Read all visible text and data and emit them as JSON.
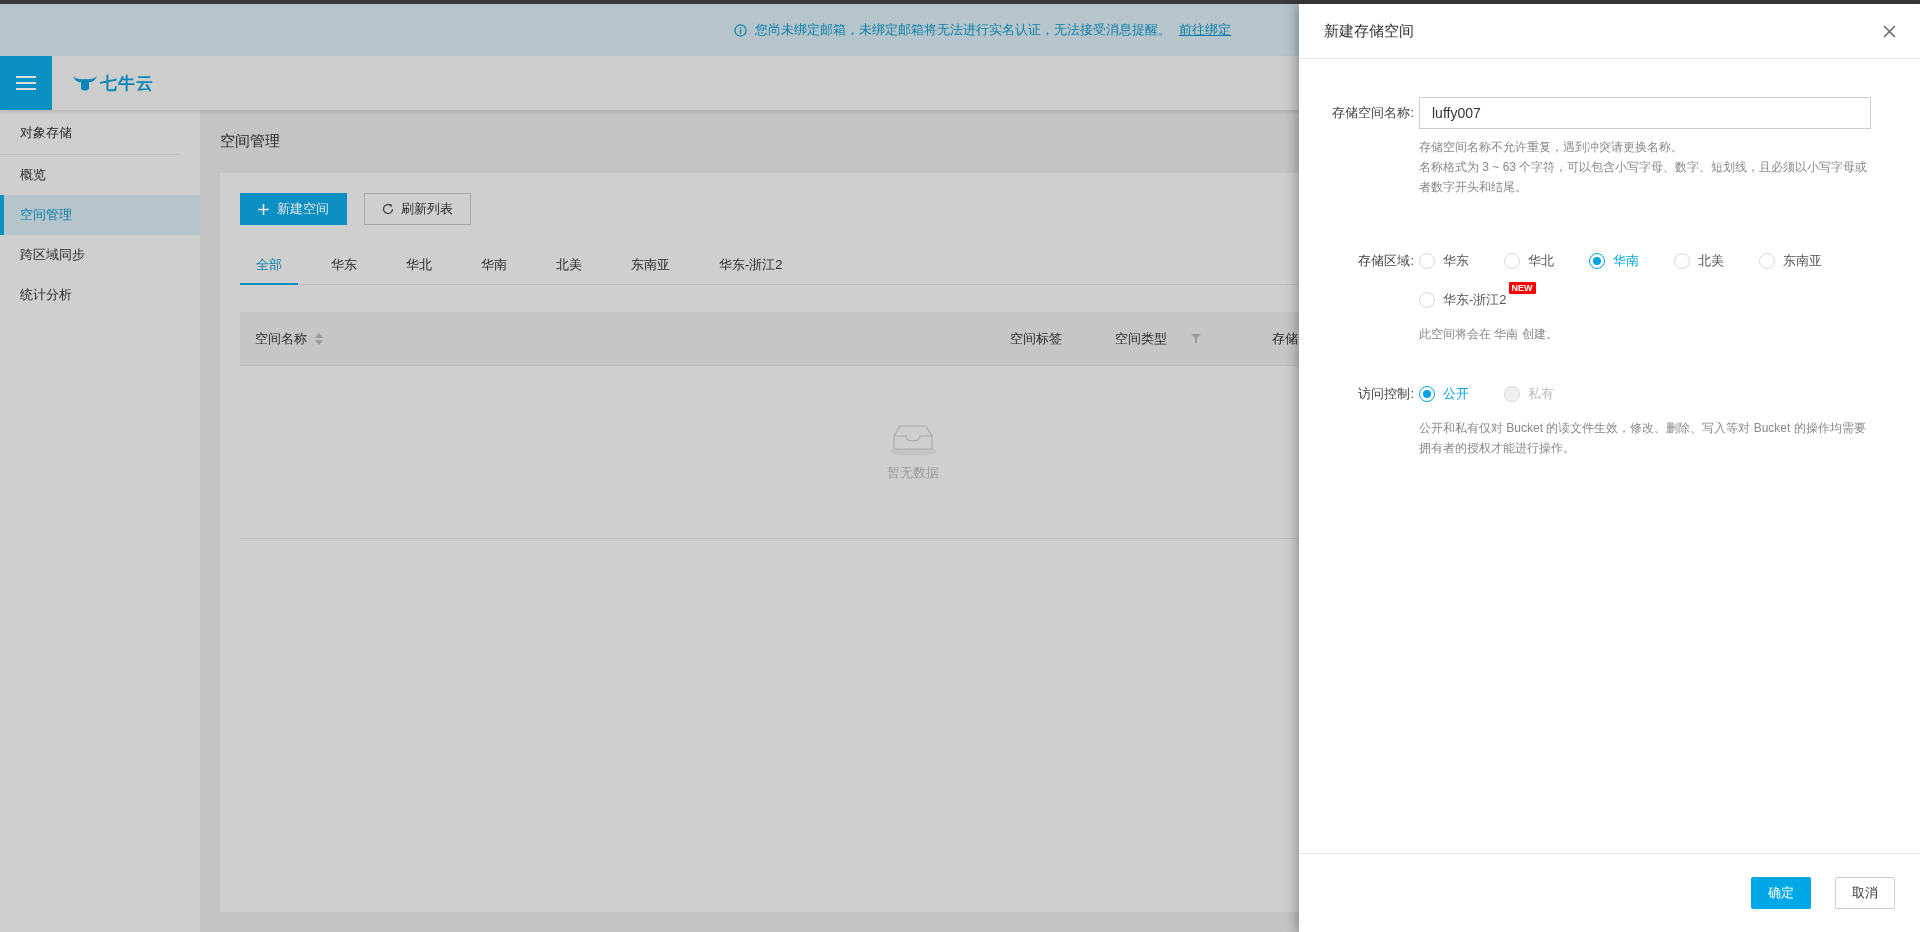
{
  "banner": {
    "message": "您尚未绑定邮箱，未绑定邮箱将无法进行实名认证，无法接受消息提醒。",
    "link": "前往绑定"
  },
  "header": {
    "logo_text": "七牛云"
  },
  "sidebar": {
    "section": "对象存储",
    "items": [
      {
        "label": "概览",
        "selected": false
      },
      {
        "label": "空间管理",
        "selected": true
      },
      {
        "label": "跨区域同步",
        "selected": false
      },
      {
        "label": "统计分析",
        "selected": false
      }
    ]
  },
  "page_title": "空间管理",
  "toolbar": {
    "new_button": "新建空间",
    "refresh_button": "刷新列表"
  },
  "region_tabs": [
    {
      "label": "全部",
      "selected": true
    },
    {
      "label": "华东",
      "selected": false
    },
    {
      "label": "华北",
      "selected": false
    },
    {
      "label": "华南",
      "selected": false
    },
    {
      "label": "北美",
      "selected": false
    },
    {
      "label": "东南亚",
      "selected": false
    },
    {
      "label": "华东-浙江2",
      "selected": false
    }
  ],
  "table": {
    "columns": [
      {
        "label": "空间名称",
        "kind": "sort"
      },
      {
        "label": "空间标签",
        "kind": "plain"
      },
      {
        "label": "空间类型",
        "kind": "filter"
      },
      {
        "label": "存储",
        "kind": "plain"
      }
    ],
    "empty_text": "暂无数据"
  },
  "drawer": {
    "title": "新建存储空间",
    "name_field": {
      "label": "存储空间名称:",
      "value": "luffy007",
      "help": [
        "存储空间名称不允许重复，遇到冲突请更换名称。",
        "名称格式为 3 ~ 63 个字符，可以包含小写字母、数字、短划线，且必须以小写字母或者数字开头和结尾。"
      ]
    },
    "region": {
      "label": "存储区域:",
      "options": [
        {
          "label": "华东",
          "selected": false
        },
        {
          "label": "华北",
          "selected": false
        },
        {
          "label": "华南",
          "selected": true
        },
        {
          "label": "北美",
          "selected": false
        },
        {
          "label": "东南亚",
          "selected": false
        },
        {
          "label": "华东-浙江2",
          "selected": false,
          "badge": "NEW"
        }
      ],
      "note": "此空间将会在 华南 创建。"
    },
    "access": {
      "label": "访问控制:",
      "options": [
        {
          "label": "公开",
          "selected": true,
          "disabled": false
        },
        {
          "label": "私有",
          "selected": false,
          "disabled": true
        }
      ],
      "note": "公开和私有仅对 Bucket 的读文件生效，修改、删除、写入等对 Bucket 的操作均需要拥有者的授权才能进行操作。"
    },
    "confirm_button": "确定",
    "cancel_button": "取消"
  }
}
